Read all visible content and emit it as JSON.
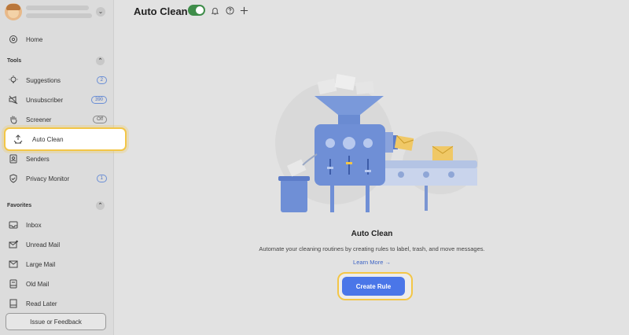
{
  "page": {
    "title": "Auto Clean",
    "toggle_on": true
  },
  "sidebar": {
    "home_label": "Home",
    "tools_heading": "Tools",
    "tools": [
      {
        "label": "Suggestions",
        "badge": "2",
        "icon": "lightbulb-icon"
      },
      {
        "label": "Unsubscriber",
        "badge": "390",
        "icon": "megaphone-off-icon"
      },
      {
        "label": "Screener",
        "badge": "Off",
        "icon": "hand-icon"
      },
      {
        "label": "Auto Clean",
        "icon": "recycle-icon"
      },
      {
        "label": "Senders",
        "icon": "contact-card-icon"
      },
      {
        "label": "Privacy Monitor",
        "badge": "1",
        "icon": "shield-check-icon"
      }
    ],
    "favorites_heading": "Favorites",
    "favorites": [
      {
        "label": "Inbox",
        "icon": "inbox-icon"
      },
      {
        "label": "Unread Mail",
        "icon": "unread-mail-icon"
      },
      {
        "label": "Large Mail",
        "icon": "large-mail-icon"
      },
      {
        "label": "Old Mail",
        "icon": "old-mail-icon"
      },
      {
        "label": "Read Later",
        "icon": "bookmark-icon"
      }
    ],
    "feedback_label": "Issue or Feedback"
  },
  "empty_state": {
    "title": "Auto Clean",
    "description": "Automate your cleaning routines by creating rules to label, trash, and move messages.",
    "learn_more": "Learn More →",
    "cta": "Create Rule"
  },
  "colors": {
    "accent": "#4a76e8",
    "highlight": "#f3c647",
    "toggle": "#3f8d4a"
  }
}
